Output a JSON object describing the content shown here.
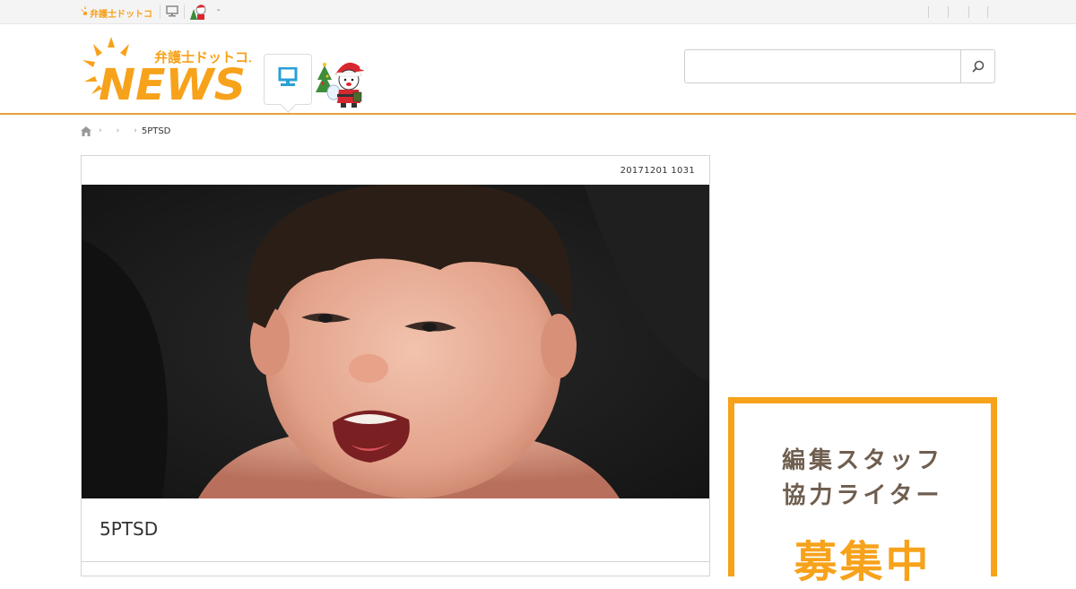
{
  "topbar": {
    "dash": "-"
  },
  "logo": {
    "brand_text": "弁護士ドットコム",
    "news_text": "NEWS",
    "mini_text": "弁護士ドットコム"
  },
  "search": {
    "value": "",
    "placeholder": ""
  },
  "breadcrumb": {
    "current": "5PTSD"
  },
  "article": {
    "date": "20171201 1031",
    "title": "5PTSD"
  },
  "banner": {
    "line1": "編集スタッフ",
    "line2": "協力ライター",
    "big": "募集中"
  },
  "colors": {
    "brand_orange": "#f7a21b",
    "accent_line": "#e8a13a",
    "pc_icon_blue": "#2a9fd6",
    "banner_text": "#6f5e4f"
  },
  "icons": [
    "pc-icon",
    "santa-mascot-icon",
    "search-icon",
    "home-icon"
  ]
}
